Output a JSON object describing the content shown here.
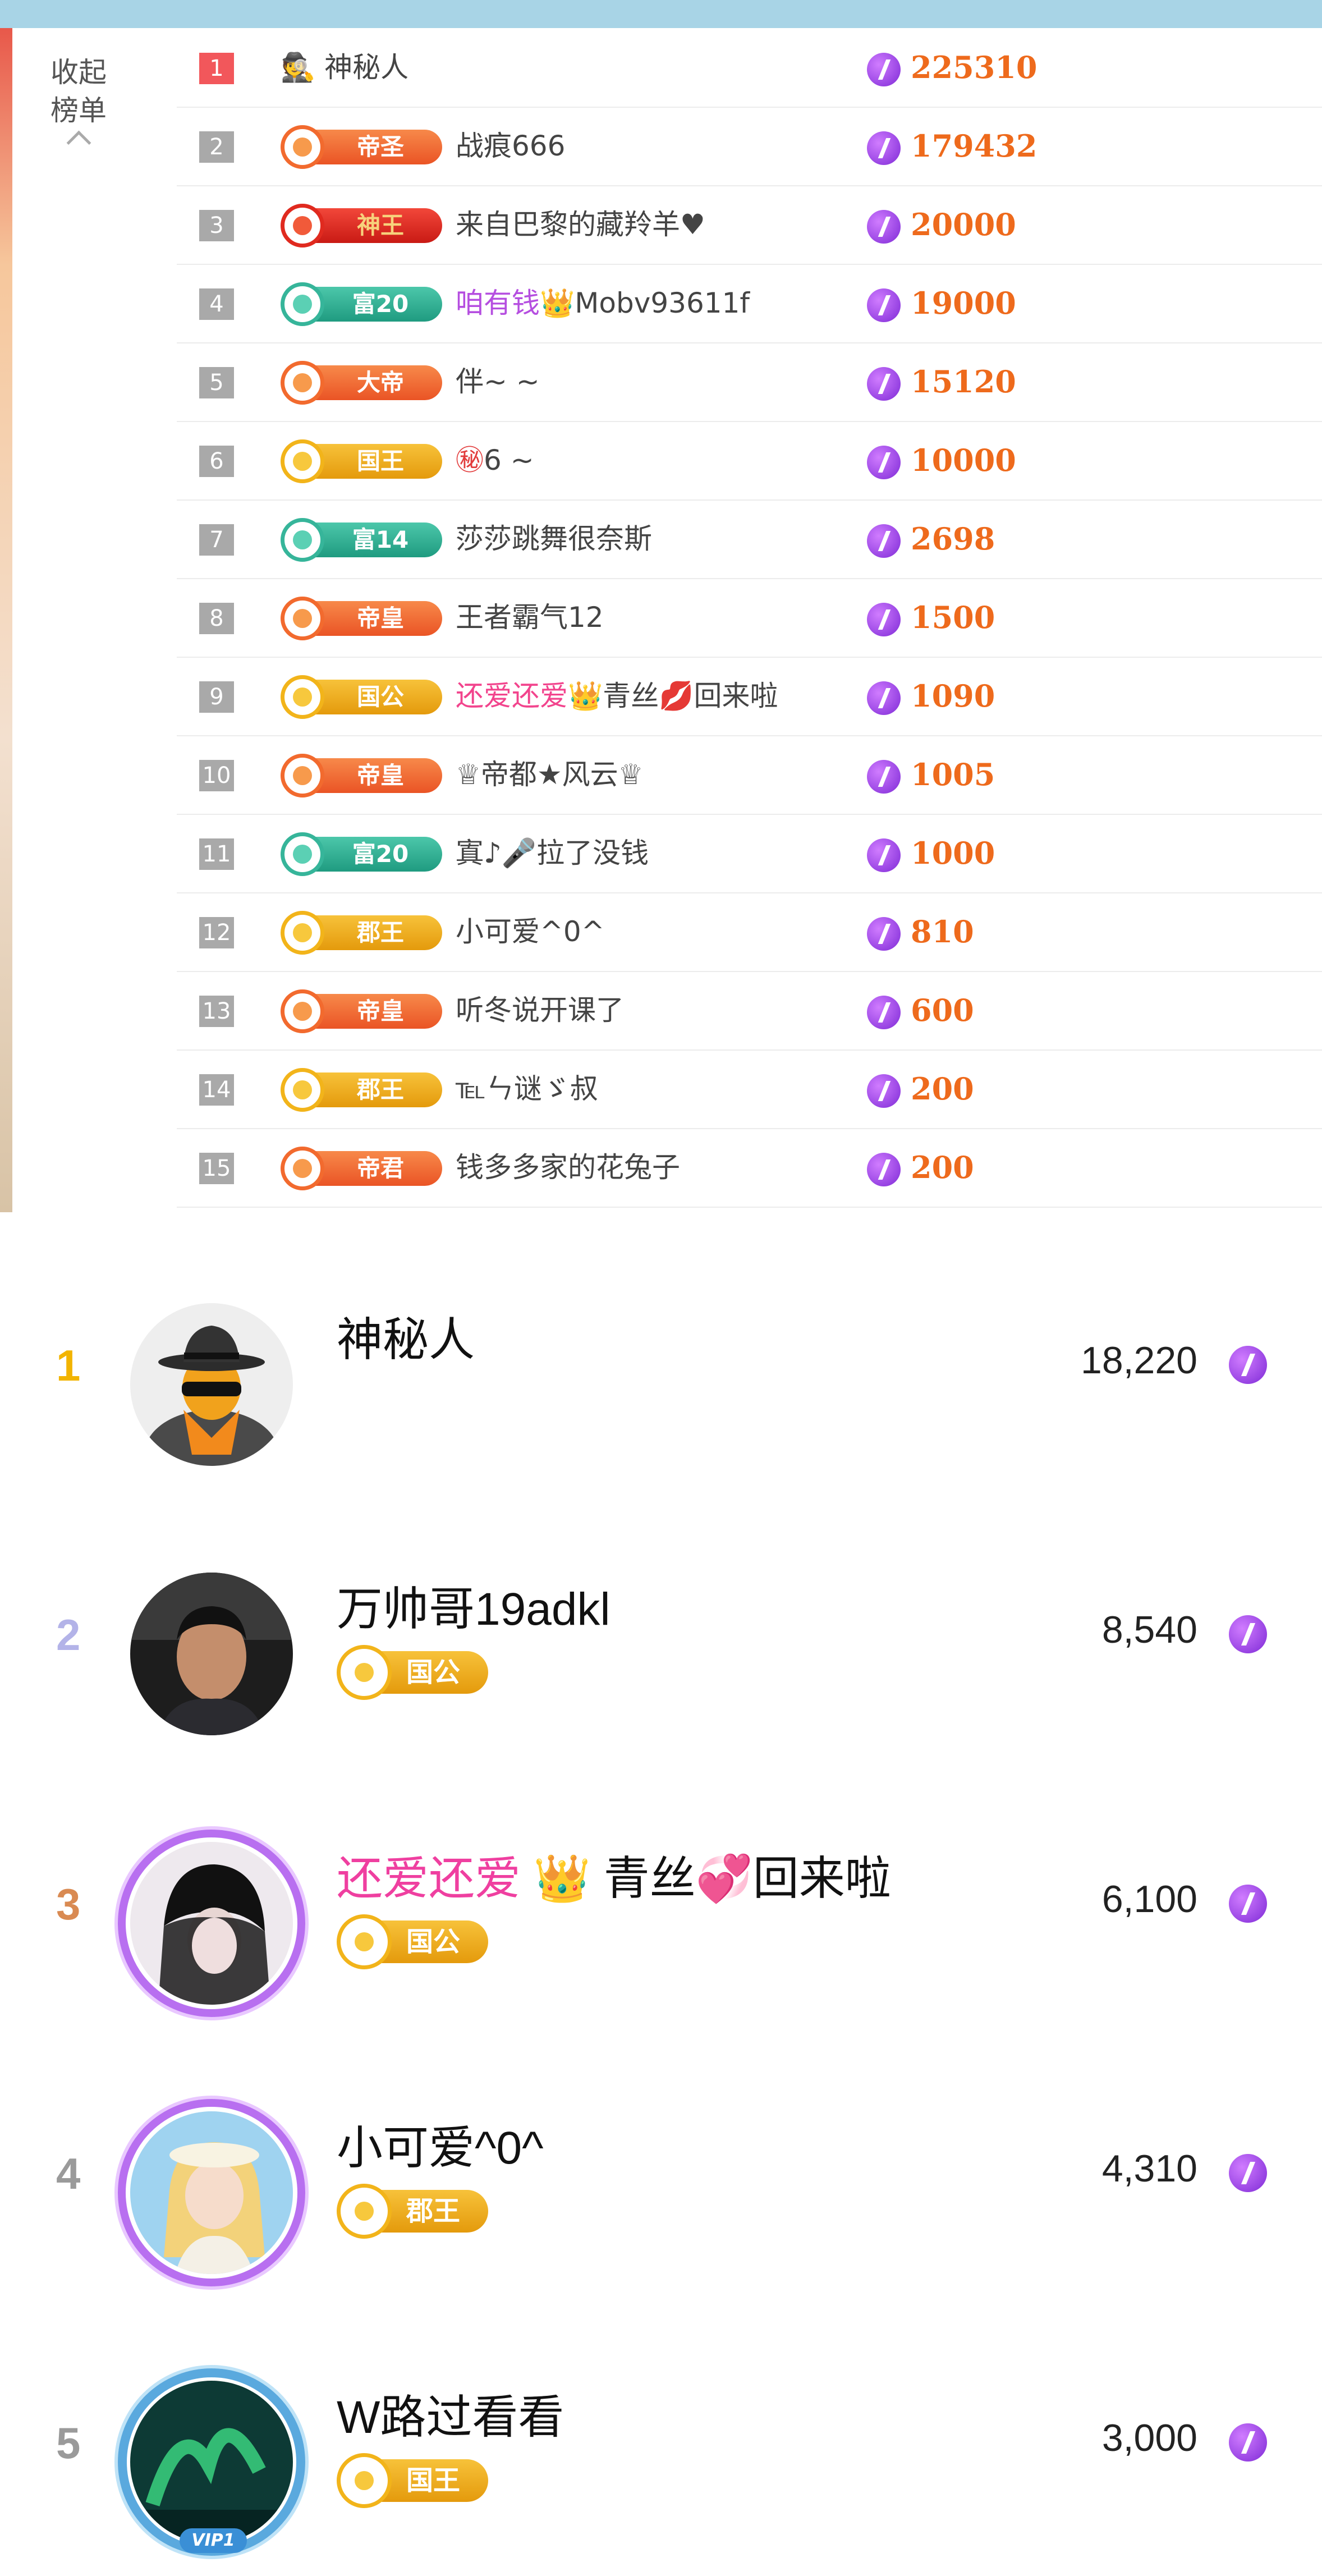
{
  "panel": {
    "collapse_label": "收起\n榜单"
  },
  "leaderboard": [
    {
      "rank": "1",
      "badge": "",
      "badge_style": "none",
      "name": [
        {
          "t": "🕵 神秘人",
          "c": ""
        }
      ],
      "score": "225310"
    },
    {
      "rank": "2",
      "badge": "帝圣",
      "badge_style": "b-orange",
      "name": [
        {
          "t": "战痕666",
          "c": ""
        }
      ],
      "score": "179432"
    },
    {
      "rank": "3",
      "badge": "神王",
      "badge_style": "b-red",
      "name": [
        {
          "t": "来自巴黎的藏羚羊♥",
          "c": ""
        }
      ],
      "score": "20000"
    },
    {
      "rank": "4",
      "badge": "富20",
      "badge_style": "b-teal",
      "name": [
        {
          "t": "咱有钱",
          "c": "acc-purple"
        },
        {
          "t": "👑",
          "c": "acc-purple"
        },
        {
          "t": "Mobv93611f",
          "c": ""
        }
      ],
      "score": "19000"
    },
    {
      "rank": "5",
      "badge": "大帝",
      "badge_style": "b-orange",
      "name": [
        {
          "t": "伴~ ~",
          "c": ""
        }
      ],
      "score": "15120"
    },
    {
      "rank": "6",
      "badge": "国王",
      "badge_style": "b-gold",
      "name": [
        {
          "t": "㊙",
          "c": "acc-red"
        },
        {
          "t": "6 ~",
          "c": ""
        }
      ],
      "score": "10000"
    },
    {
      "rank": "7",
      "badge": "富14",
      "badge_style": "b-teal",
      "name": [
        {
          "t": "莎莎跳舞很奈斯",
          "c": ""
        }
      ],
      "score": "2698"
    },
    {
      "rank": "8",
      "badge": "帝皇",
      "badge_style": "b-orange",
      "name": [
        {
          "t": "王者霸气12",
          "c": ""
        }
      ],
      "score": "1500"
    },
    {
      "rank": "9",
      "badge": "国公",
      "badge_style": "b-gold",
      "name": [
        {
          "t": "还爱还爱",
          "c": "acc-pink"
        },
        {
          "t": "👑",
          "c": "acc-pink"
        },
        {
          "t": "青丝",
          "c": ""
        },
        {
          "t": "💋",
          "c": "acc-red"
        },
        {
          "t": "回来啦",
          "c": ""
        }
      ],
      "score": "1090"
    },
    {
      "rank": "10",
      "badge": "帝皇",
      "badge_style": "b-orange",
      "name": [
        {
          "t": "♕帝都★风云♕",
          "c": ""
        }
      ],
      "score": "1005"
    },
    {
      "rank": "11",
      "badge": "富20",
      "badge_style": "b-teal",
      "name": [
        {
          "t": "寘♪🎤拉了没钱",
          "c": ""
        }
      ],
      "score": "1000"
    },
    {
      "rank": "12",
      "badge": "郡王",
      "badge_style": "b-gold",
      "name": [
        {
          "t": "小可爱^0^",
          "c": ""
        }
      ],
      "score": "810"
    },
    {
      "rank": "13",
      "badge": "帝皇",
      "badge_style": "b-orange",
      "name": [
        {
          "t": "听冬说开课了",
          "c": ""
        }
      ],
      "score": "600"
    },
    {
      "rank": "14",
      "badge": "郡王",
      "badge_style": "b-gold",
      "name": [
        {
          "t": "℡ㄣ谜ゞ叔",
          "c": ""
        }
      ],
      "score": "200"
    },
    {
      "rank": "15",
      "badge": "帝君",
      "badge_style": "b-orange",
      "name": [
        {
          "t": "钱多多家的花兔子",
          "c": ""
        }
      ],
      "score": "200"
    }
  ],
  "fans": [
    {
      "rank": "1",
      "rank_color": "#f2b400",
      "avatar": "spy-avatar",
      "name": [
        {
          "t": "神秘人",
          "c": ""
        }
      ],
      "badge": "",
      "score": "18,220"
    },
    {
      "rank": "2",
      "rank_color": "#b3b3e8",
      "avatar": "man-photo-avatar",
      "name": [
        {
          "t": "万帅哥19adkl",
          "c": ""
        }
      ],
      "badge": "国公",
      "score": "8,540"
    },
    {
      "rank": "3",
      "rank_color": "#d98a52",
      "avatar": "girl-hat-avatar",
      "name": [
        {
          "t": "还爱还爱 ",
          "c": "p"
        },
        {
          "t": "👑",
          "c": "p"
        },
        {
          "t": " 青丝💞回来啦",
          "c": ""
        }
      ],
      "badge": "国公",
      "score": "6,100"
    },
    {
      "rank": "4",
      "rank_color": "#9a9a9a",
      "avatar": "blonde-girl-avatar",
      "name": [
        {
          "t": "小可爱^0^",
          "c": ""
        }
      ],
      "badge": "郡王",
      "score": "4,310"
    },
    {
      "rank": "5",
      "rank_color": "#9a9a9a",
      "avatar": "aurora-vip-avatar",
      "name": [
        {
          "t": "W路过看看",
          "c": ""
        }
      ],
      "badge": "国王",
      "score": "3,000"
    }
  ],
  "vip_label": "VIP1",
  "colors": {
    "score_orange": "#ee6a1c",
    "gift_purple": "#8a35dd",
    "rank_red": "#f2575b"
  }
}
